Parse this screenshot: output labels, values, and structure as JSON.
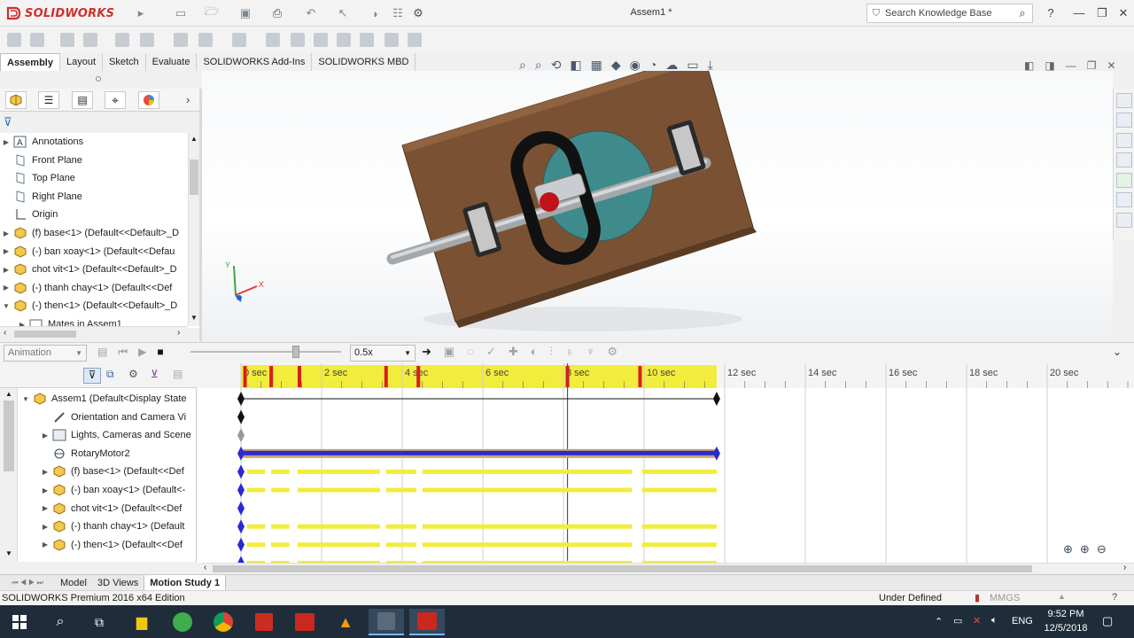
{
  "app": {
    "brand": "SOLIDWORKS",
    "document_title": "Assem1 *",
    "search_placeholder": "Search Knowledge Base"
  },
  "ribbon_tabs": [
    "Assembly",
    "Layout",
    "Sketch",
    "Evaluate",
    "SOLIDWORKS Add-Ins",
    "SOLIDWORKS MBD"
  ],
  "feature_tree": {
    "items": [
      {
        "label": "Annotations",
        "expandable": true,
        "icon": "annotations-icon"
      },
      {
        "label": "Front Plane",
        "expandable": false,
        "icon": "plane-icon"
      },
      {
        "label": "Top Plane",
        "expandable": false,
        "icon": "plane-icon"
      },
      {
        "label": "Right Plane",
        "expandable": false,
        "icon": "plane-icon"
      },
      {
        "label": "Origin",
        "expandable": false,
        "icon": "origin-icon"
      },
      {
        "label": "(f) base<1> (Default<<Default>_D",
        "expandable": true,
        "icon": "part-icon"
      },
      {
        "label": "(-) ban xoay<1> (Default<<Defau",
        "expandable": true,
        "icon": "part-icon"
      },
      {
        "label": "chot vit<1> (Default<<Default>_D",
        "expandable": true,
        "icon": "part-icon"
      },
      {
        "label": "(-) thanh chay<1> (Default<<Def",
        "expandable": true,
        "icon": "part-icon"
      },
      {
        "label": "(-) then<1> (Default<<Default>_D",
        "expandable": true,
        "icon": "part-icon"
      },
      {
        "label": "Mates in Assem1",
        "expandable": true,
        "icon": "mates-icon"
      }
    ]
  },
  "motion": {
    "study_type": "Animation",
    "playback_speed": "0.5x",
    "time_labels": [
      "0 sec",
      "2 sec",
      "4 sec",
      "6 sec",
      "8 sec",
      "10 sec",
      "12 sec",
      "14 sec",
      "16 sec",
      "18 sec",
      "20 sec"
    ],
    "timebar_position_sec": 8.1,
    "active_duration_sec": 11.8,
    "tree": [
      {
        "label": "Assem1  (Default<Display State",
        "icon": "assembly-icon",
        "expandable": true
      },
      {
        "label": "Orientation and Camera Vi",
        "icon": "camera-icon",
        "expandable": false
      },
      {
        "label": "Lights, Cameras and Scene",
        "icon": "scene-icon",
        "expandable": true
      },
      {
        "label": "RotaryMotor2",
        "icon": "motor-icon",
        "expandable": false
      },
      {
        "label": "(f) base<1> (Default<<Def",
        "icon": "part-icon",
        "expandable": true
      },
      {
        "label": "(-) ban xoay<1> (Default<-",
        "icon": "part-icon",
        "expandable": true
      },
      {
        "label": "chot vit<1> (Default<<Def",
        "icon": "part-icon",
        "expandable": true
      },
      {
        "label": "(-) thanh chay<1> (Default",
        "icon": "part-icon",
        "expandable": true
      },
      {
        "label": "(-) then<1> (Default<<Def",
        "icon": "part-icon",
        "expandable": true
      }
    ]
  },
  "bottom_tabs": [
    "Model",
    "3D Views",
    "Motion Study 1"
  ],
  "status": {
    "edition": "SOLIDWORKS Premium 2016 x64 Edition",
    "state": "Under Defined",
    "units": "MMGS"
  },
  "taskbar": {
    "time": "9:52 PM",
    "date": "12/5/2018",
    "lang": "ENG"
  },
  "colors": {
    "brand_red": "#d0312d",
    "timeline_yellow": "#f2ec3c",
    "marker_red": "#d61f1f",
    "motor_blue": "#2a2ad1",
    "motor_tan": "#c9a56a",
    "plate_brown": "#7a5233"
  }
}
